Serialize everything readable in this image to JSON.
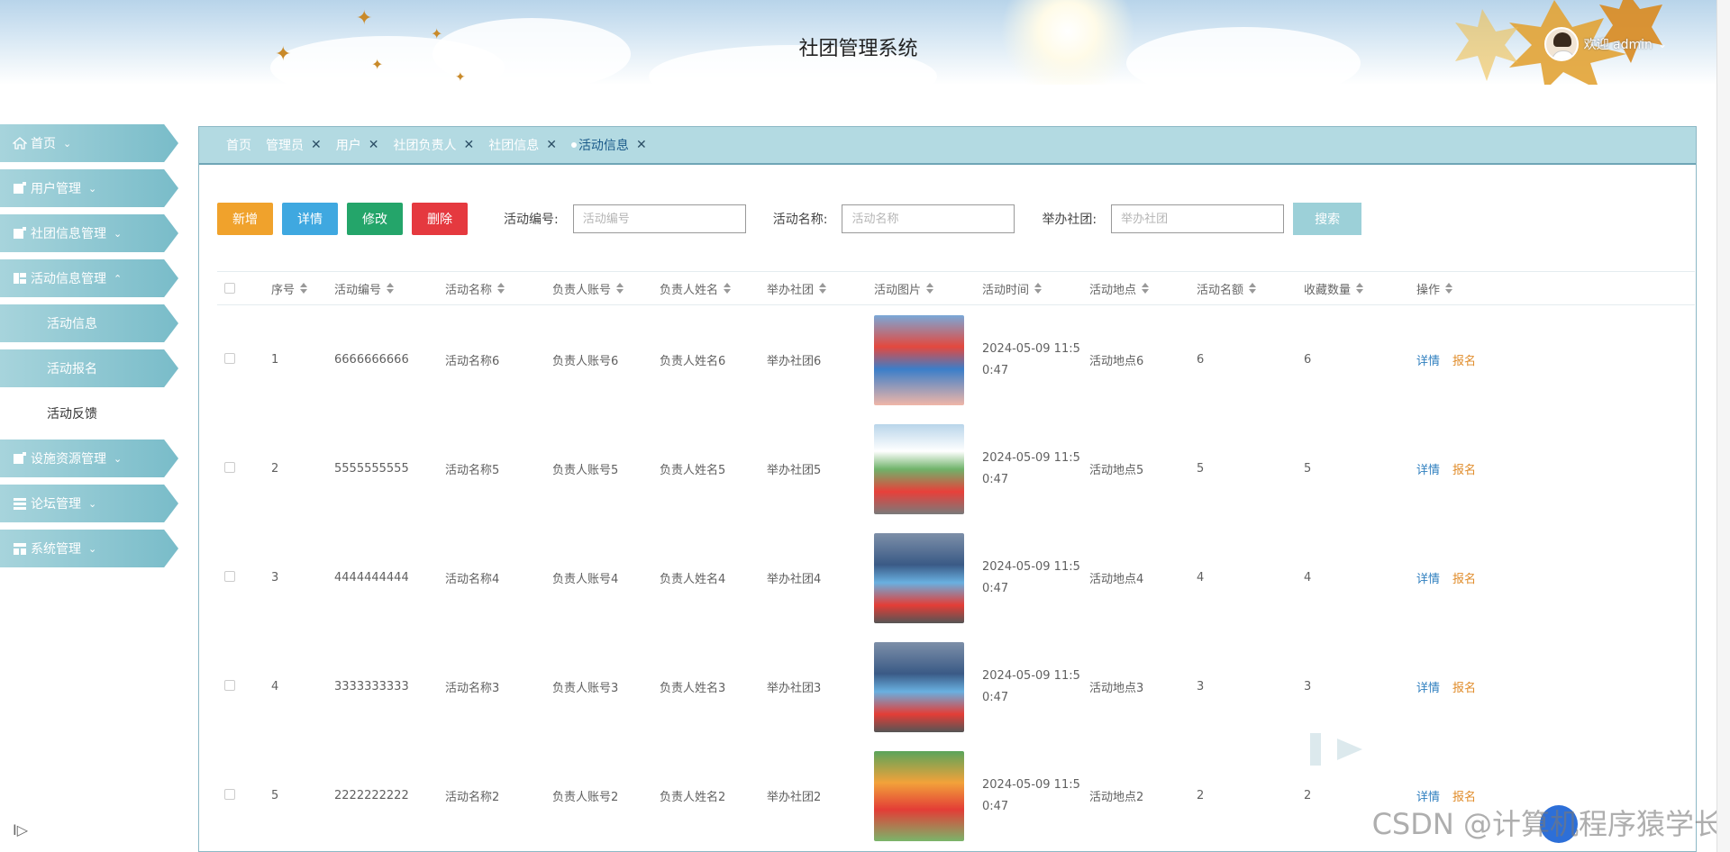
{
  "header": {
    "title": "社团管理系统",
    "welcome": "欢迎 admin",
    "caret": "⌄"
  },
  "sidebar": {
    "items": [
      {
        "label": "首页",
        "icon": "home-icon"
      },
      {
        "label": "用户管理",
        "icon": "user-manage-icon"
      },
      {
        "label": "社团信息管理",
        "icon": "club-info-icon"
      },
      {
        "label": "活动信息管理",
        "icon": "activity-icon",
        "expanded": true
      },
      {
        "label": "设施资源管理",
        "icon": "facility-icon"
      },
      {
        "label": "论坛管理",
        "icon": "forum-icon"
      },
      {
        "label": "系统管理",
        "icon": "system-icon"
      }
    ],
    "subitems": [
      {
        "label": "活动信息"
      },
      {
        "label": "活动报名"
      },
      {
        "label": "活动反馈"
      }
    ],
    "collapse": "I▷"
  },
  "tabs": [
    {
      "label": "首页",
      "closable": false
    },
    {
      "label": "管理员",
      "closable": true
    },
    {
      "label": "用户",
      "closable": true
    },
    {
      "label": "社团负责人",
      "closable": true
    },
    {
      "label": "社团信息",
      "closable": true
    },
    {
      "label": "活动信息",
      "closable": true,
      "active": true
    }
  ],
  "toolbar": {
    "add": "新增",
    "detail": "详情",
    "edit": "修改",
    "delete": "删除",
    "search": "搜索",
    "filters": [
      {
        "label": "活动编号:",
        "placeholder": "活动编号"
      },
      {
        "label": "活动名称:",
        "placeholder": "活动名称"
      },
      {
        "label": "举办社团:",
        "placeholder": "举办社团"
      }
    ]
  },
  "table": {
    "headers": [
      "序号",
      "活动编号",
      "活动名称",
      "负责人账号",
      "负责人姓名",
      "举办社团",
      "活动图片",
      "活动时间",
      "活动地点",
      "活动名额",
      "收藏数量",
      "操作"
    ],
    "rows": [
      {
        "no": "1",
        "code": "6666666666",
        "name": "活动名称6",
        "account": "负责人账号6",
        "person": "负责人姓名6",
        "club": "举办社团6",
        "time1": "2024-05-09 11:5",
        "time2": "0:47",
        "place": "活动地点6",
        "quota": "6",
        "fav": "6"
      },
      {
        "no": "2",
        "code": "5555555555",
        "name": "活动名称5",
        "account": "负责人账号5",
        "person": "负责人姓名5",
        "club": "举办社团5",
        "time1": "2024-05-09 11:5",
        "time2": "0:47",
        "place": "活动地点5",
        "quota": "5",
        "fav": "5"
      },
      {
        "no": "3",
        "code": "4444444444",
        "name": "活动名称4",
        "account": "负责人账号4",
        "person": "负责人姓名4",
        "club": "举办社团4",
        "time1": "2024-05-09 11:5",
        "time2": "0:47",
        "place": "活动地点4",
        "quota": "4",
        "fav": "4"
      },
      {
        "no": "4",
        "code": "3333333333",
        "name": "活动名称3",
        "account": "负责人账号3",
        "person": "负责人姓名3",
        "club": "举办社团3",
        "time1": "2024-05-09 11:5",
        "time2": "0:47",
        "place": "活动地点3",
        "quota": "3",
        "fav": "3"
      },
      {
        "no": "5",
        "code": "2222222222",
        "name": "活动名称2",
        "account": "负责人账号2",
        "person": "负责人姓名2",
        "club": "举办社团2",
        "time1": "2024-05-09 11:5",
        "time2": "0:47",
        "place": "活动地点2",
        "quota": "2",
        "fav": "2"
      }
    ],
    "op_detail": "详情",
    "op_signup": "报名"
  },
  "watermark": "CSDN @计算机程序猿学长",
  "colors": {
    "sidebar": "#79bcc9",
    "tabbar": "#b3dae2",
    "add": "#f0a22c",
    "detail": "#3fa8e0",
    "edit": "#24a56a",
    "delete": "#e5393f",
    "search": "#9cd0d8",
    "link": "#2f7fbf",
    "signup": "#e08c2a"
  }
}
